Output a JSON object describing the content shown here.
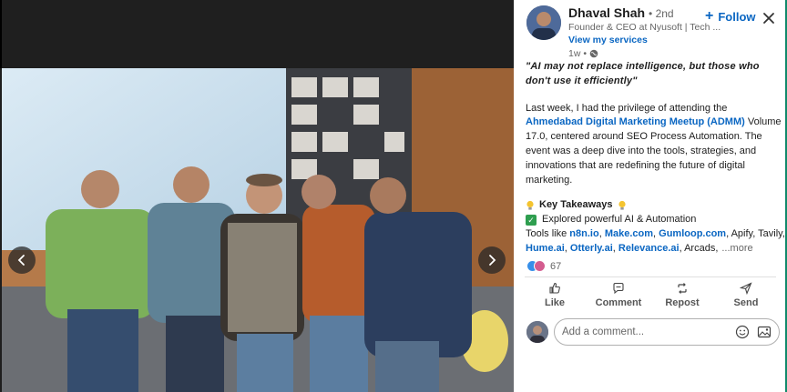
{
  "author": {
    "name": "Dhaval Shah",
    "degree": "• 2nd",
    "headline": "Founder & CEO at Nyusoft | Tech ...",
    "view_services": "View my services",
    "time": "1w •"
  },
  "follow": {
    "plus": "+",
    "label": "Follow"
  },
  "post": {
    "quote": "\"AI may not replace intelligence, but those who don't use it efficiently\"",
    "p1_a": "Last week, I had the privilege of attending the ",
    "p1_link": "Ahmedabad Digital Marketing Meetup (ADMM)",
    "p1_b": " Volume 17.0, centered around SEO Process Automation. The event was a deep dive into the tools, strategies, and innovations that are redefining the future of digital marketing.",
    "key_takeaways": "Key Takeaways",
    "bullet1": "Explored powerful AI & Automation",
    "tools_prefix": "Tools like ",
    "tool1": "n8n.io",
    "tool2": "Make.com",
    "tool3": "Gumloop.com",
    "tools_mid": ", Apify, Tavily, ",
    "tool4": "Hume.ai",
    "tool5": "Otterly.ai",
    "tool6": "Relevance.ai",
    "tools_end": ", Arcads,",
    "more": "...more",
    "sep": ", ",
    "after_last": ", "
  },
  "reactions": {
    "count": "67"
  },
  "actions": [
    {
      "label": "Like",
      "icon": "thumbs-up-icon"
    },
    {
      "label": "Comment",
      "icon": "comment-icon"
    },
    {
      "label": "Repost",
      "icon": "repost-icon"
    },
    {
      "label": "Send",
      "icon": "send-icon"
    }
  ],
  "comment": {
    "placeholder": "Add a comment..."
  },
  "colors": {
    "link": "#0a66c2",
    "accent_border": "#0f8a6b"
  }
}
